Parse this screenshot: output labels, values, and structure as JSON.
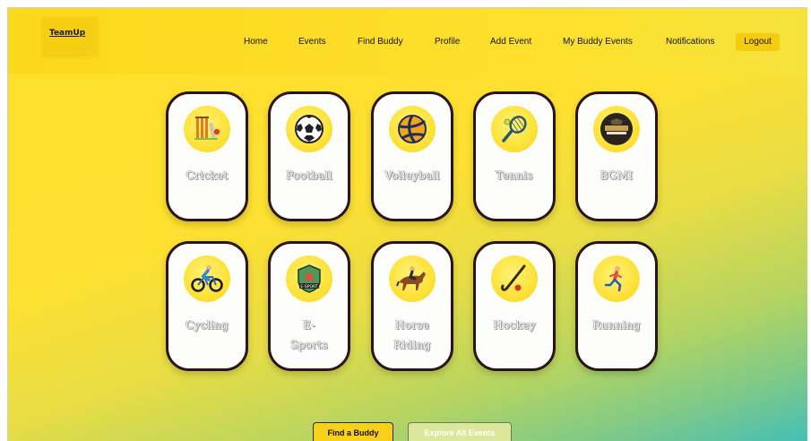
{
  "brand": {
    "name": "TeamUp"
  },
  "nav": {
    "items": [
      {
        "label": "Home"
      },
      {
        "label": "Events"
      },
      {
        "label": "Find Buddy"
      },
      {
        "label": "Profile"
      },
      {
        "label": "Add Event"
      },
      {
        "label": "My Buddy Events"
      },
      {
        "label": "Notifications"
      }
    ],
    "logout_label": "Logout"
  },
  "sports": [
    {
      "label": "Cricket",
      "icon": "cricket-icon"
    },
    {
      "label": "Football",
      "icon": "football-icon"
    },
    {
      "label": "Volleyball",
      "icon": "volleyball-icon"
    },
    {
      "label": "Tennis",
      "icon": "tennis-icon"
    },
    {
      "label": "BGMI",
      "icon": "bgmi-icon"
    },
    {
      "label": "Cycling",
      "icon": "cycling-icon"
    },
    {
      "label": "E-\nSports",
      "icon": "esports-icon"
    },
    {
      "label": "Horse\nRiding",
      "icon": "horse-riding-icon"
    },
    {
      "label": "Hockey",
      "icon": "hockey-icon"
    },
    {
      "label": "Running",
      "icon": "running-icon"
    }
  ],
  "actions": {
    "find_buddy_label": "Find a Buddy",
    "explore_label": "Explore All Events"
  },
  "colors": {
    "accent": "#fde02a",
    "card_border": "#2a1415",
    "gradient_end": "#45bfb6"
  }
}
